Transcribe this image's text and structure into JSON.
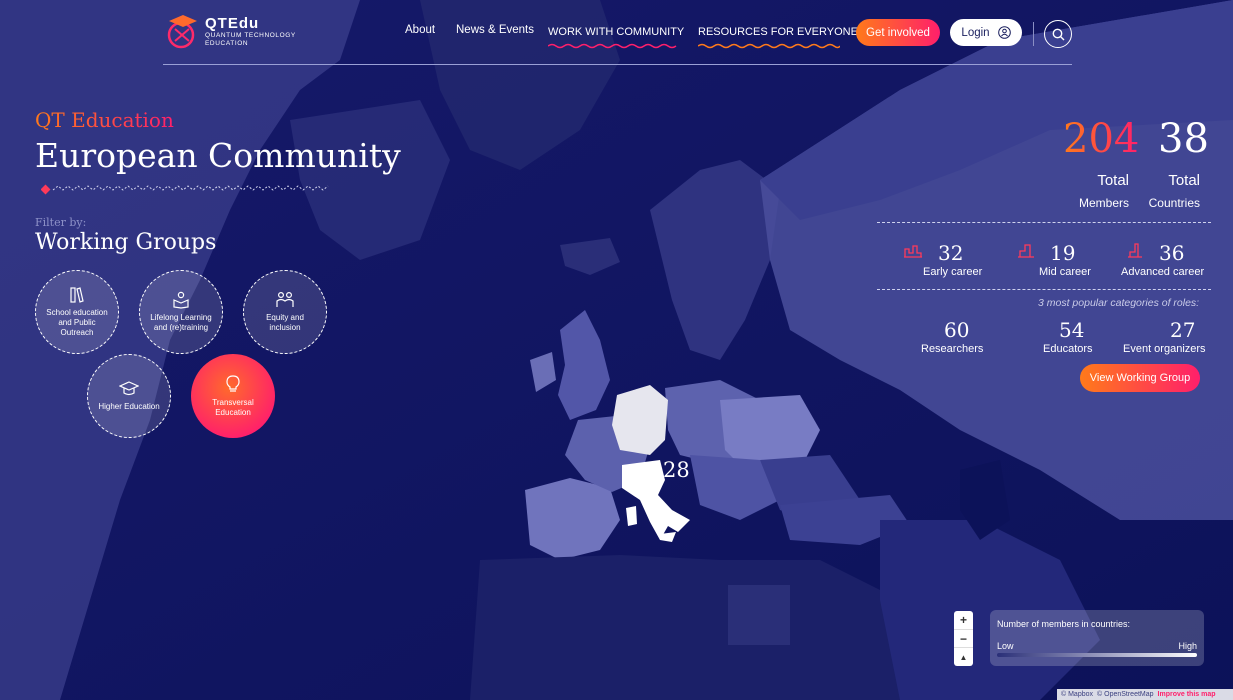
{
  "brand": {
    "name": "QTEdu",
    "subtitle_line1": "QUANTUM TECHNOLOGY",
    "subtitle_line2": "EDUCATION"
  },
  "nav": {
    "about": "About",
    "news": "News & Events",
    "work": "WORK WITH COMMUNITY",
    "resources": "RESOURCES FOR EVERYONE",
    "get_involved": "Get involved",
    "login": "Login"
  },
  "hero": {
    "eyebrow": "QT Education",
    "title": "European Community"
  },
  "filter": {
    "label": "Filter by:",
    "title": "Working Groups",
    "groups": [
      {
        "label": "School education and Public Outreach",
        "icon": "books-icon"
      },
      {
        "label": "Lifelong Learning and (re)training",
        "icon": "learner-icon"
      },
      {
        "label": "Equity and inclusion",
        "icon": "people-icon"
      },
      {
        "label": "Higher Education",
        "icon": "graduation-cap-icon"
      },
      {
        "label": "Transversal Education",
        "icon": "lightbulb-icon",
        "active": true
      }
    ]
  },
  "stats": {
    "members": {
      "value": "204",
      "label1": "Total",
      "label2": "Members"
    },
    "countries": {
      "value": "38",
      "label1": "Total",
      "label2": "Countries"
    },
    "career": [
      {
        "value": "32",
        "label": "Early career"
      },
      {
        "value": "19",
        "label": "Mid career"
      },
      {
        "value": "36",
        "label": "Advanced career"
      }
    ],
    "roles_note": "3 most popular categories of roles:",
    "roles": [
      {
        "value": "60",
        "label": "Researchers"
      },
      {
        "value": "54",
        "label": "Educators"
      },
      {
        "value": "27",
        "label": "Event organizers"
      }
    ],
    "view_button": "View Working Group"
  },
  "map": {
    "highlight_count": "28",
    "zoom_in": "+",
    "zoom_out": "−",
    "reset": "▲",
    "legend_title": "Number of members in countries:",
    "legend_low": "Low",
    "legend_high": "High",
    "attribution": [
      "© Mapbox",
      "© OpenStreetMap",
      "Improve this map"
    ]
  },
  "colors": {
    "accent_orange": "#ff7a1a",
    "accent_pink": "#ff1f6b",
    "background": "#0a0f55"
  }
}
